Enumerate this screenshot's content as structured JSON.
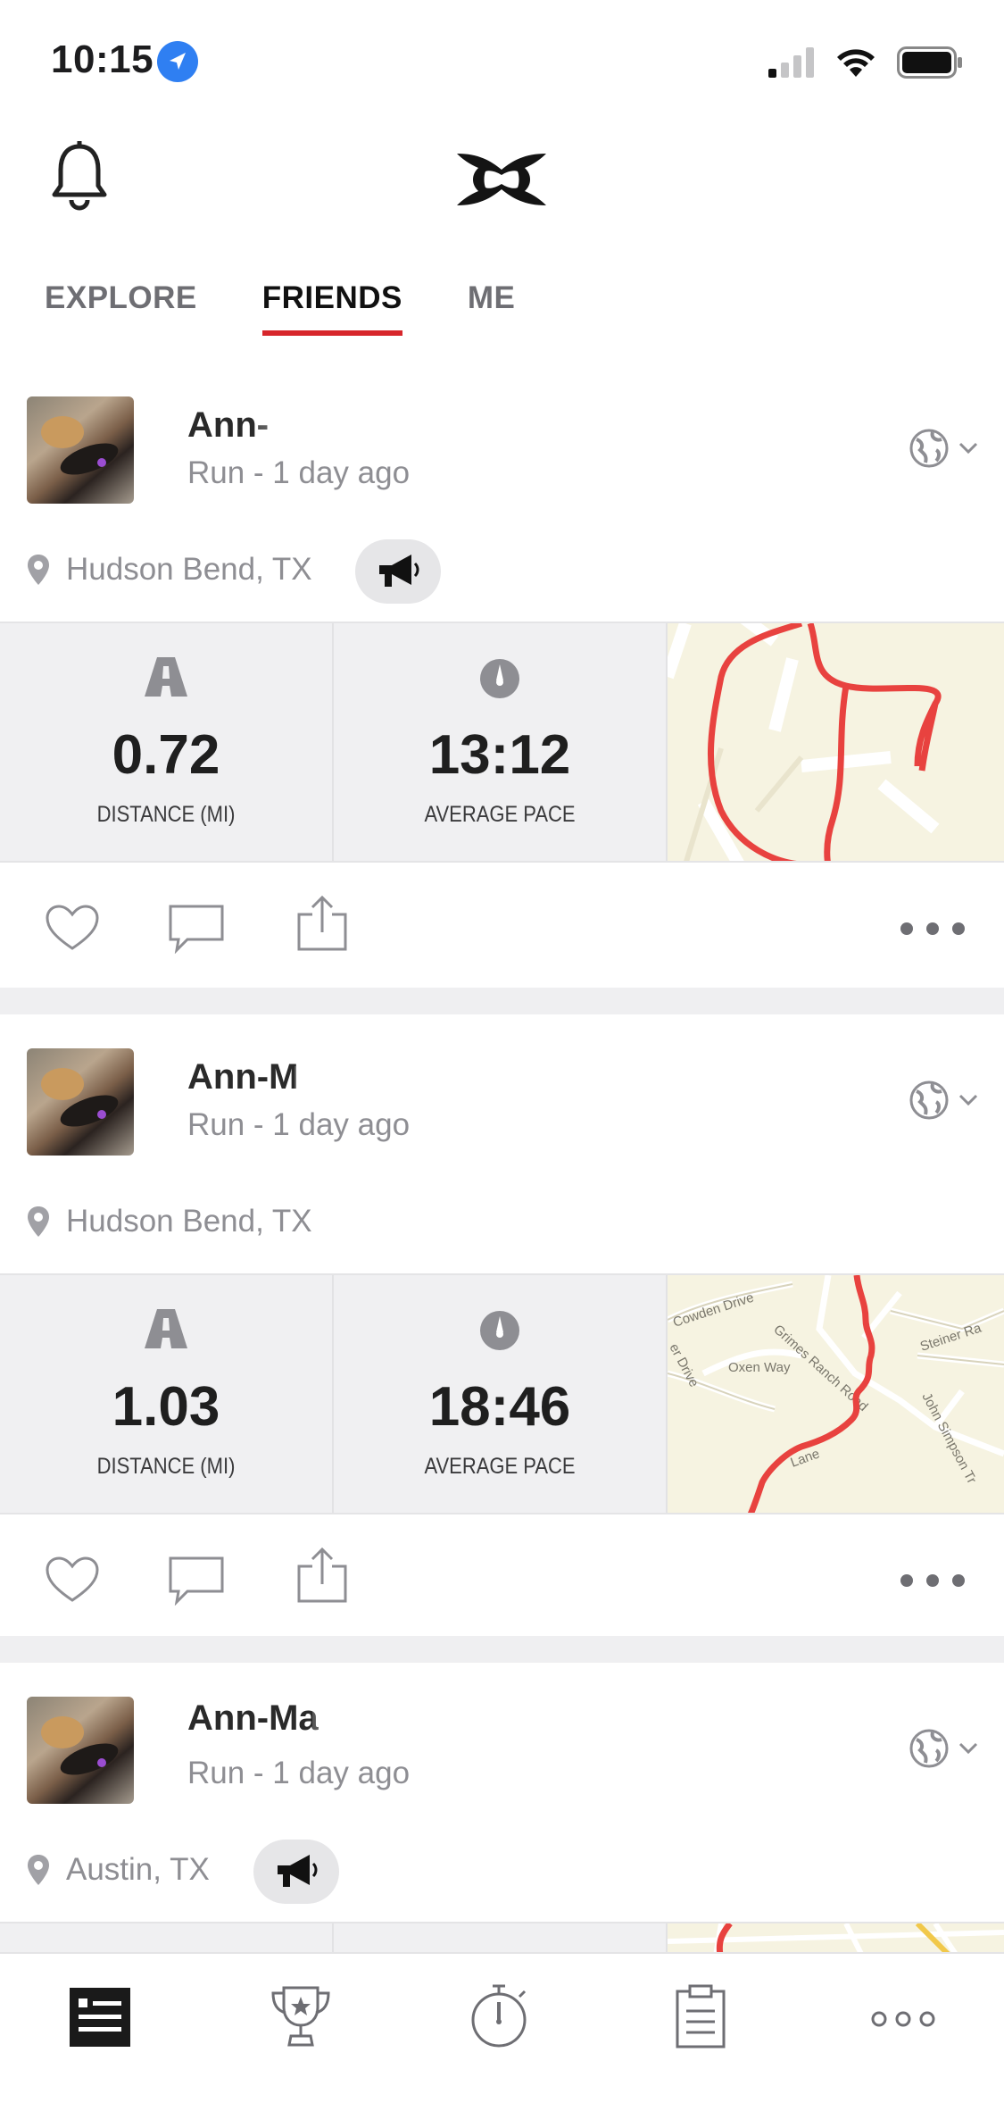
{
  "status_bar": {
    "time": "10:15"
  },
  "tabs": [
    {
      "label": "EXPLORE",
      "active": false
    },
    {
      "label": "FRIENDS",
      "active": true
    },
    {
      "label": "ME",
      "active": false
    }
  ],
  "posts": [
    {
      "name": "Ann-",
      "subtitle": "Run - 1 day ago",
      "location": "Hudson Bend, TX",
      "shoutout": true,
      "distance": "0.72",
      "distance_label": "DISTANCE (MI)",
      "pace": "13:12",
      "pace_label": "AVERAGE PACE"
    },
    {
      "name": "Ann-M",
      "subtitle": "Run - 1 day ago",
      "location": "Hudson Bend, TX",
      "shoutout": false,
      "distance": "1.03",
      "distance_label": "DISTANCE (MI)",
      "pace": "18:46",
      "pace_label": "AVERAGE PACE",
      "map_labels": [
        "Cowden Drive",
        "Grimes Ranch Road",
        "Oxen Way",
        "Steiner Ra",
        "John Simpson Tr",
        "er Drive",
        "Lane"
      ]
    },
    {
      "name": "Ann-Ma",
      "subtitle": "Run - 1 day ago",
      "location": "Austin, TX",
      "shoutout": true
    }
  ],
  "colors": {
    "accent": "#d7262b",
    "route": "#e8423f",
    "stat_bg": "#f0f0f2",
    "map_bg": "#f6f3e1"
  },
  "icons": [
    "bell-icon",
    "under-armour-logo",
    "globe-icon",
    "chevron-down-icon",
    "location-pin-icon",
    "megaphone-icon",
    "road-icon",
    "speedometer-icon",
    "heart-icon",
    "comment-icon",
    "share-icon",
    "more-icon",
    "feed-icon",
    "trophy-icon",
    "stopwatch-icon",
    "clipboard-icon"
  ]
}
